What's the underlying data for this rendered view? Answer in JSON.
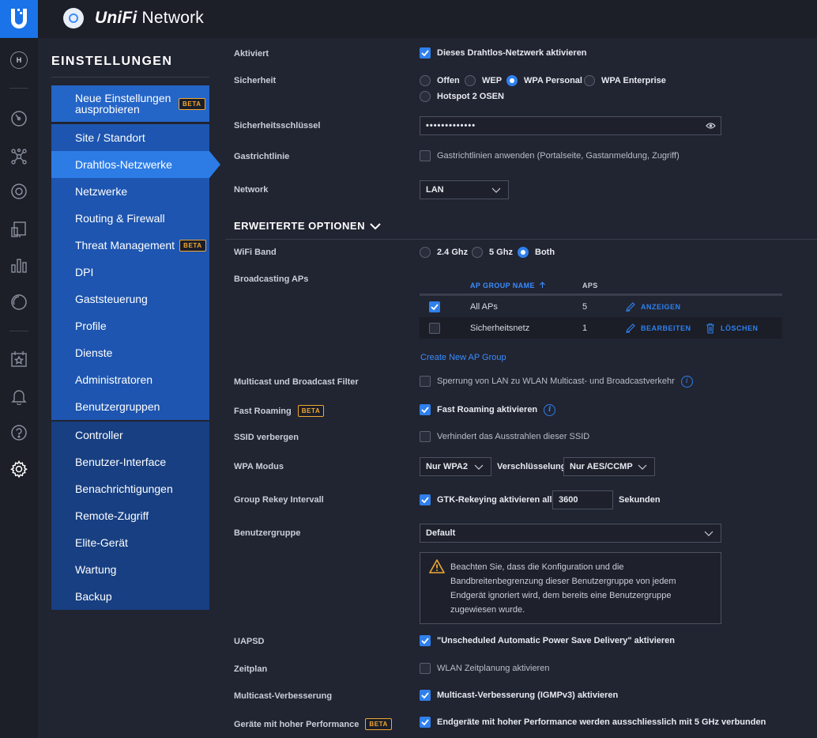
{
  "app": {
    "brand": "UniFi",
    "name": "Network"
  },
  "rail": {
    "avatar_letter": "H"
  },
  "settings": {
    "heading": "EINSTELLUNGEN",
    "beta": "BETA",
    "nav": [
      {
        "label": "Neue Einstellungen ausprobieren",
        "beta": true
      },
      {
        "label": "Site / Standort"
      },
      {
        "label": "Drahtlos-Netzwerke",
        "active": true
      },
      {
        "label": "Netzwerke"
      },
      {
        "label": "Routing & Firewall"
      },
      {
        "label": "Threat Management",
        "beta": true
      },
      {
        "label": "DPI"
      },
      {
        "label": "Gaststeuerung"
      },
      {
        "label": "Profile"
      },
      {
        "label": "Dienste"
      },
      {
        "label": "Administratoren"
      },
      {
        "label": "Benutzergruppen"
      },
      {
        "label": "Controller"
      },
      {
        "label": "Benutzer-Interface"
      },
      {
        "label": "Benachrichtigungen"
      },
      {
        "label": "Remote-Zugriff"
      },
      {
        "label": "Elite-Gerät"
      },
      {
        "label": "Wartung"
      },
      {
        "label": "Backup"
      }
    ]
  },
  "form": {
    "enabled": {
      "label": "Aktiviert",
      "text": "Dieses Drahtlos-Netzwerk aktivieren",
      "checked": true
    },
    "security": {
      "label": "Sicherheit",
      "options": [
        "Offen",
        "WEP",
        "WPA Personal",
        "WPA Enterprise",
        "Hotspot 2 OSEN"
      ],
      "selected": "WPA Personal"
    },
    "key": {
      "label": "Sicherheitsschlüssel",
      "value": "•••••••••••••"
    },
    "guest_policy": {
      "label": "Gastrichtlinie",
      "text": "Gastrichtlinien anwenden (Portalseite, Gastanmeldung, Zugriff)",
      "checked": false
    },
    "network": {
      "label": "Network",
      "value": "LAN"
    }
  },
  "advanced": {
    "title": "ERWEITERTE OPTIONEN",
    "wifi_band": {
      "label": "WiFi Band",
      "options": [
        "2.4 Ghz",
        "5 Ghz",
        "Both"
      ],
      "selected": "Both"
    },
    "broadcasting": {
      "label": "Broadcasting APs",
      "columns": {
        "name": "AP GROUP NAME",
        "aps": "APS"
      },
      "rows": [
        {
          "name": "All APs",
          "aps": "5",
          "checked": true,
          "action": "ANZEIGEN"
        },
        {
          "name": "Sicherheitsnetz",
          "aps": "1",
          "checked": false,
          "action": "BEARBEITEN",
          "delete": "LÖSCHEN"
        }
      ],
      "create_link": "Create New AP Group"
    },
    "multicast_filter": {
      "label": "Multicast und Broadcast Filter",
      "text": "Sperrung von LAN zu WLAN Multicast- und Broadcastverkehr",
      "checked": false
    },
    "fast_roaming": {
      "label": "Fast Roaming",
      "text": "Fast Roaming aktivieren",
      "checked": true
    },
    "hide_ssid": {
      "label": "SSID verbergen",
      "text": "Verhindert das Ausstrahlen dieser SSID",
      "checked": false
    },
    "wpa_mode": {
      "label": "WPA Modus",
      "value": "Nur WPA2",
      "enc_label": "Verschlüsselung",
      "enc_value": "Nur AES/CCMP"
    },
    "rekey": {
      "label": "Group Rekey Intervall",
      "text": "GTK-Rekeying aktivieren alle",
      "value": "3600",
      "unit": "Sekunden",
      "checked": true
    },
    "user_group": {
      "label": "Benutzergruppe",
      "value": "Default",
      "warning": "Beachten Sie, dass die Konfiguration und die Bandbreitenbegrenzung dieser Benutzergruppe von jedem Endgerät ignoriert wird, dem bereits eine Benutzergruppe zugewiesen wurde."
    },
    "uapsd": {
      "label": "UAPSD",
      "text": "\"Unscheduled Automatic Power Save Delivery\" aktivieren",
      "checked": true
    },
    "schedule": {
      "label": "Zeitplan",
      "text": "WLAN Zeitplanung aktivieren",
      "checked": false
    },
    "multicast_enh": {
      "label": "Multicast-Verbesserung",
      "text": "Multicast-Verbesserung (IGMPv3) aktivieren",
      "checked": true
    },
    "high_perf": {
      "label": "Geräte mit hoher Performance",
      "text": "Endgeräte mit hoher Performance werden ausschliesslich mit 5 GHz verbunden",
      "checked": true
    }
  },
  "colors": {
    "accent": "#2f80ed",
    "beta": "#f0a830",
    "background": "#212431"
  }
}
